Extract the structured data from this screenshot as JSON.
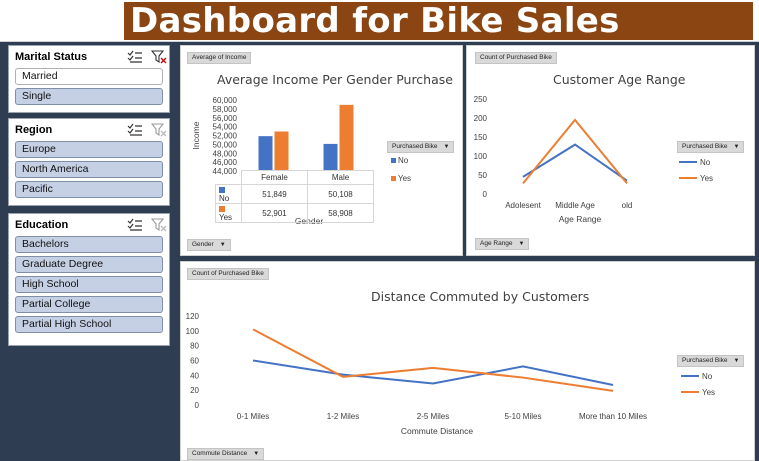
{
  "header": {
    "title": "Dashboard for Bike Sales",
    "title_bg": "#8a4512"
  },
  "slicers": {
    "marital": {
      "title": "Marital Status",
      "items": [
        {
          "label": "Married",
          "selected": false
        },
        {
          "label": "Single",
          "selected": true
        }
      ]
    },
    "region": {
      "title": "Region",
      "items": [
        {
          "label": "Europe"
        },
        {
          "label": "North America"
        },
        {
          "label": "Pacific"
        }
      ]
    },
    "education": {
      "title": "Education",
      "items": [
        {
          "label": "Bachelors"
        },
        {
          "label": "Graduate Degree"
        },
        {
          "label": "High School"
        },
        {
          "label": "Partial College"
        },
        {
          "label": "Partial High School"
        }
      ]
    }
  },
  "colors": {
    "no": "#4472c4",
    "yes": "#ed7d31",
    "slicer_selected": "#c6d0e4"
  },
  "income_panel": {
    "field_button": "Average of Income",
    "filter_button": "Gender",
    "legend_button": "Purchased Bike",
    "legend": [
      "No",
      "Yes"
    ],
    "table": {
      "headers": [
        "Female",
        "Male"
      ],
      "rows": [
        {
          "label": "No",
          "values": [
            "51,849",
            "50,108"
          ]
        },
        {
          "label": "Yes",
          "values": [
            "52,901",
            "58,908"
          ]
        }
      ]
    }
  },
  "age_panel": {
    "field_button": "Count of Purchased Bike",
    "filter_button": "Age Range",
    "legend_button": "Purchased Bike",
    "legend": [
      "No",
      "Yes"
    ]
  },
  "distance_panel": {
    "field_button": "Count of Purchased Bike",
    "filter_button": "Commute Distance",
    "legend_button": "Purchased Bike",
    "legend": [
      "No",
      "Yes"
    ]
  },
  "chart_data": [
    {
      "type": "bar",
      "title": "Average Income Per Gender Purchase",
      "xlabel": "Gender",
      "ylabel": "Income",
      "categories": [
        "Female",
        "Male"
      ],
      "series": [
        {
          "name": "No",
          "values": [
            51849,
            50108
          ]
        },
        {
          "name": "Yes",
          "values": [
            52901,
            58908
          ]
        }
      ],
      "ylim": [
        44000,
        60000
      ],
      "yticks": [
        "60,000",
        "58,000",
        "56,000",
        "54,000",
        "52,000",
        "50,000",
        "48,000",
        "46,000",
        "44,000"
      ],
      "legend": "right"
    },
    {
      "type": "line",
      "title": "Customer Age Range",
      "xlabel": "Age Range",
      "ylabel": "",
      "categories": [
        "Adolesent",
        "Middle Age",
        "old"
      ],
      "series": [
        {
          "name": "No",
          "values": [
            45,
            130,
            35
          ]
        },
        {
          "name": "Yes",
          "values": [
            28,
            195,
            28
          ]
        }
      ],
      "ylim": [
        0,
        250
      ],
      "yticks": [
        "250",
        "200",
        "150",
        "100",
        "50",
        "0"
      ],
      "legend": "right"
    },
    {
      "type": "line",
      "title": "Distance Commuted by Customers",
      "xlabel": "Commute Distance",
      "ylabel": "",
      "categories": [
        "0-1 Miles",
        "1-2 Miles",
        "2-5 Miles",
        "5-10 Miles",
        "More than 10 Miles"
      ],
      "series": [
        {
          "name": "No",
          "values": [
            60,
            41,
            29,
            52,
            27
          ]
        },
        {
          "name": "Yes",
          "values": [
            102,
            38,
            50,
            37,
            19
          ]
        }
      ],
      "ylim": [
        0,
        120
      ],
      "yticks": [
        "120",
        "100",
        "80",
        "60",
        "40",
        "20",
        "0"
      ],
      "legend": "right"
    }
  ]
}
